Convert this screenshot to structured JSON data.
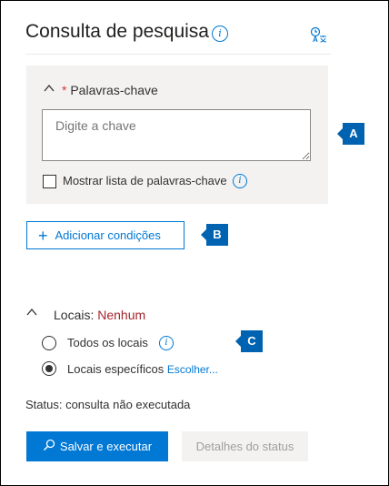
{
  "header": {
    "title": "Consulta de pesquisa",
    "info_icon": "info-icon",
    "language_icon": "translate-icon"
  },
  "keywords": {
    "required_marker": "*",
    "label": "Palavras-chave",
    "input_placeholder": "Digite a chave",
    "input_value": "",
    "checkbox_label": "Mostrar lista de palavras-chave",
    "checkbox_checked": false
  },
  "add_conditions": {
    "label": "Adicionar condições"
  },
  "locations": {
    "label": "Locais:",
    "value": "Nenhum",
    "options": [
      {
        "label": "Todos os locais",
        "selected": false
      },
      {
        "label": "Locais específicos",
        "selected": true,
        "link": "Escolher..."
      }
    ]
  },
  "status": {
    "text": "Status: consulta não executada"
  },
  "actions": {
    "save_run": "Salvar e executar",
    "status_details": "Detalhes do status"
  },
  "callouts": [
    "A",
    "B",
    "C"
  ],
  "colors": {
    "accent": "#0078d4",
    "callout": "#0063b1",
    "none_value": "#a4262c",
    "required": "#d13438",
    "panel_bg": "#f3f2f1"
  }
}
